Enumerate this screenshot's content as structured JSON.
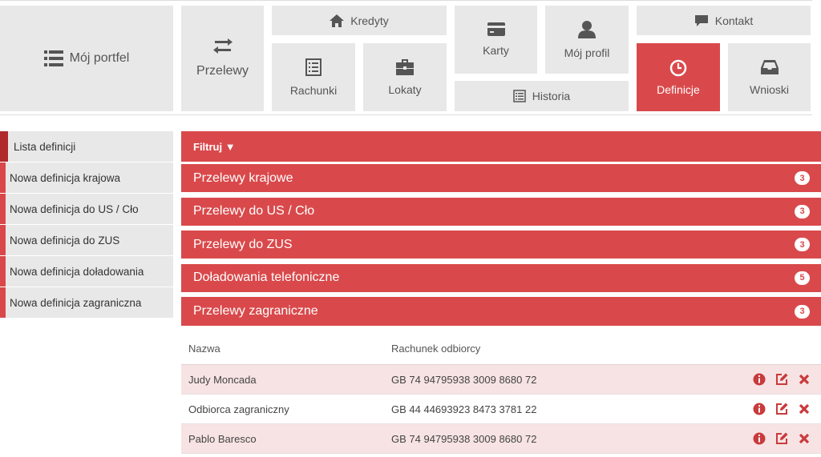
{
  "nav": {
    "portfolio": {
      "label": "Mój portfel",
      "icon": "list-icon"
    },
    "transfers": {
      "label": "Przelewy",
      "icon": "transfer-arrows-icon"
    },
    "credits": {
      "label": "Kredyty",
      "icon": "home-icon"
    },
    "accounts": {
      "label": "Rachunki",
      "icon": "ledger-icon"
    },
    "deposits": {
      "label": "Lokaty",
      "icon": "briefcase-icon"
    },
    "cards": {
      "label": "Karty",
      "icon": "credit-card-icon"
    },
    "profile": {
      "label": "Mój profil",
      "icon": "user-icon"
    },
    "history": {
      "label": "Historia",
      "icon": "history-list-icon"
    },
    "contact": {
      "label": "Kontakt",
      "icon": "chat-bubble-icon"
    },
    "definitions": {
      "label": "Definicje",
      "icon": "clock-icon"
    },
    "applications": {
      "label": "Wnioski",
      "icon": "inbox-tray-icon"
    }
  },
  "sidebar": {
    "items": [
      {
        "label": "Lista definicji"
      },
      {
        "label": "Nowa definicja krajowa"
      },
      {
        "label": "Nowa definicja do US / Cło"
      },
      {
        "label": "Nowa definicja do ZUS"
      },
      {
        "label": "Nowa definicja doładowania"
      },
      {
        "label": "Nowa definicja zagraniczna"
      }
    ]
  },
  "filter": {
    "label": "Filtruj ▼"
  },
  "sections": [
    {
      "label": "Przelewy krajowe",
      "count": "3"
    },
    {
      "label": "Przelewy do US / Cło",
      "count": "3"
    },
    {
      "label": "Przelewy do ZUS",
      "count": "3"
    },
    {
      "label": "Doładowania telefoniczne",
      "count": "5"
    },
    {
      "label": "Przelewy zagraniczne",
      "count": "3"
    }
  ],
  "table": {
    "headers": {
      "name": "Nazwa",
      "account": "Rachunek odbiorcy"
    },
    "rows": [
      {
        "name": "Judy Moncada",
        "account": "GB 74 94795938 3009 8680 72"
      },
      {
        "name": "Odbiorca zagraniczny",
        "account": "GB 44 44693923 8473 3781 22"
      },
      {
        "name": "Pablo Baresco",
        "account": "GB 74 94795938 3009 8680 72"
      }
    ]
  },
  "colors": {
    "accent": "#d9494b",
    "tile": "#e8e8e8",
    "row_alt": "#f7e3e3"
  }
}
